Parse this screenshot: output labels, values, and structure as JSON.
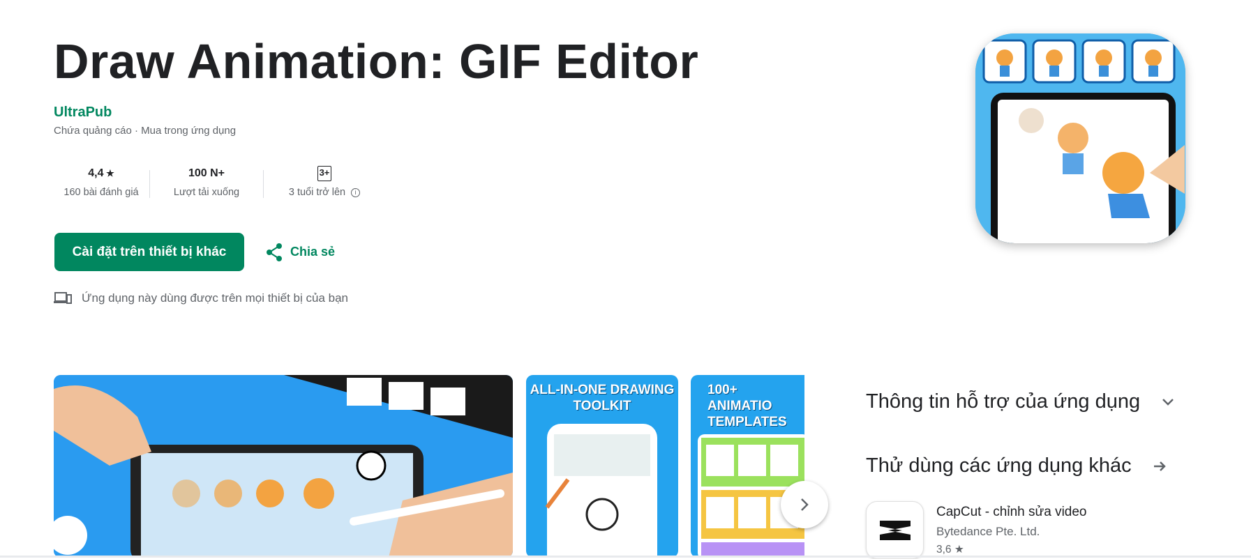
{
  "app": {
    "title": "Draw Animation: GIF Editor",
    "developer": "UltraPub",
    "ads_note": "Chứa quảng cáo · Mua trong ứng dụng"
  },
  "stats": {
    "rating": "4,4",
    "rating_label": "160 bài đánh giá",
    "downloads": "100 N+",
    "downloads_label": "Lượt tải xuống",
    "age_badge": "3+",
    "age_label": "3 tuổi trở lên"
  },
  "actions": {
    "install_label": "Cài đặt trên thiết bị khác",
    "share_label": "Chia sẻ"
  },
  "devices_note": "Ứng dụng này dùng được trên mọi thiết bị của bạn",
  "screenshots": {
    "shot2_title": "ALL-IN-ONE DRAWING TOOLKIT",
    "shot3_title": "100+ ANIMATIO TEMPLATES"
  },
  "sidebar": {
    "support_heading": "Thông tin hỗ trợ của ứng dụng",
    "other_apps_heading": "Thử dùng các ứng dụng khác",
    "apps": [
      {
        "name": "CapCut - chỉnh sửa video",
        "developer": "Bytedance Pte. Ltd.",
        "rating": "3,6"
      }
    ]
  },
  "colors": {
    "accent": "#01875f",
    "text": "#202124",
    "muted": "#5f6368"
  }
}
